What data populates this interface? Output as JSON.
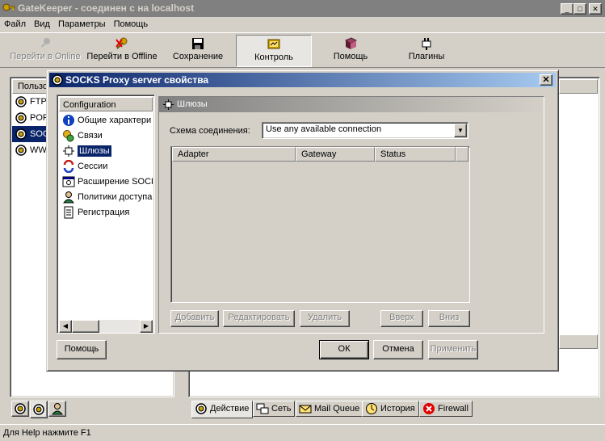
{
  "window": {
    "title": "GateKeeper - соединен с на localhost"
  },
  "menu": [
    "Файл",
    "Вид",
    "Параметры",
    "Помощь"
  ],
  "toolbar": {
    "go_online": "Перейти в Online",
    "go_offline": "Перейти в Offline",
    "save": "Сохранение",
    "control": "Контроль",
    "help": "Помощь",
    "plugins": "Плагины"
  },
  "left_panel": {
    "header": "Пользо",
    "items": [
      "FTP",
      "POP",
      "SOC",
      "WW"
    ]
  },
  "dialog": {
    "title": "SOCKS Proxy server свойства",
    "tree_header": "Configuration",
    "tree_items": [
      "Общие характери",
      "Связи",
      "Шлюзы",
      "Сессии",
      "Расширение SOCKS",
      "Политики доступа",
      "Регистрация"
    ],
    "section_title": "Шлюзы",
    "scheme_label": "Схема соединения:",
    "scheme_value": "Use any available connection",
    "columns": [
      "Adapter",
      "Gateway",
      "Status"
    ],
    "buttons": {
      "add": "Добавить",
      "edit": "Редактировать",
      "delete": "Удалить",
      "up": "Вверх",
      "down": "Вниз",
      "help": "Помощь",
      "ok": "ОК",
      "cancel": "Отмена",
      "apply": "Применить"
    }
  },
  "bottom_tabs": [
    "Действие",
    "Сеть",
    "Mail Queue",
    "История",
    "Firewall"
  ],
  "status": "Для Help нажмите F1"
}
